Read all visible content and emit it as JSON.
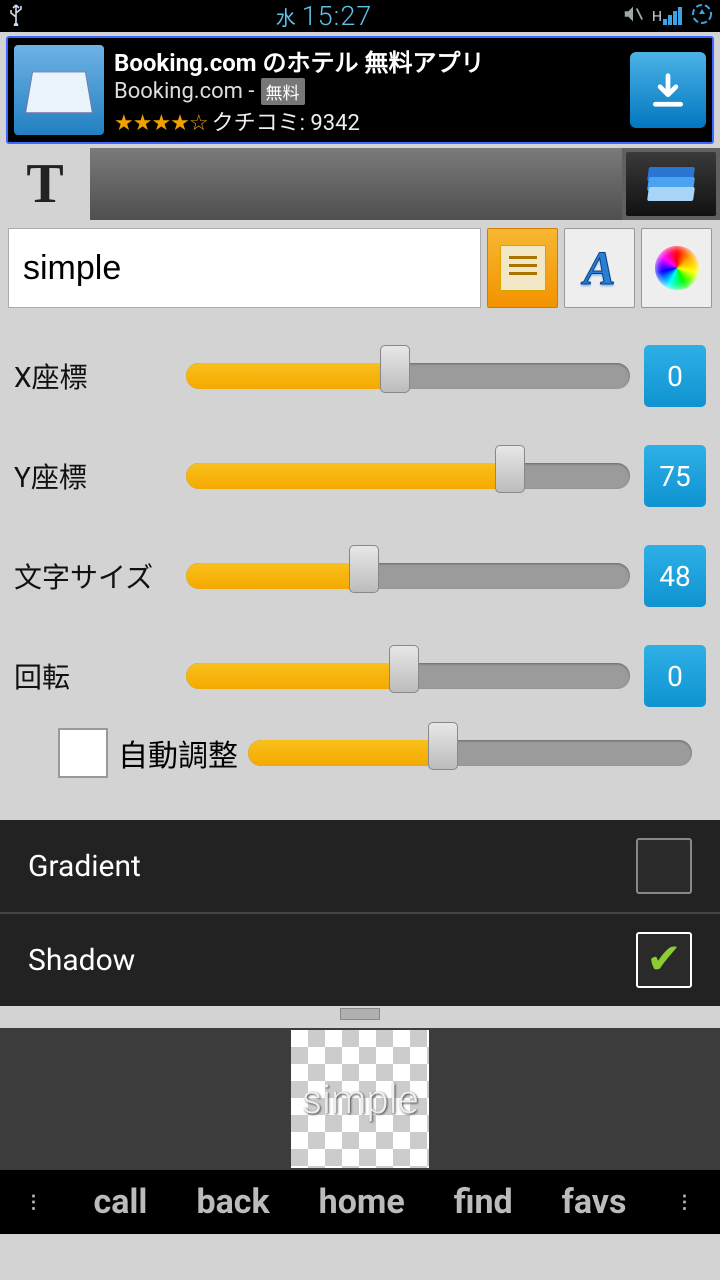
{
  "status": {
    "dow": "水",
    "clock": "15:27",
    "mobile": "H"
  },
  "ad": {
    "title": "Booking.com のホテル 無料アプリ",
    "publisher": "Booking.com - ",
    "free_badge": "無料",
    "stars": "★★★★☆",
    "reviews_label": "クチコミ: 9342"
  },
  "text_input": {
    "value": "simple"
  },
  "sliders": {
    "x": {
      "label": "X座標",
      "value": "0",
      "fill": 47
    },
    "y": {
      "label": "Y座標",
      "value": "75",
      "fill": 73
    },
    "size": {
      "label": "文字サイズ",
      "value": "48",
      "fill": 40
    },
    "rotate": {
      "label": "回転",
      "value": "0",
      "fill": 49
    },
    "auto": {
      "label": "自動調整",
      "fill": 44
    }
  },
  "options": {
    "gradient": {
      "label": "Gradient",
      "checked": false
    },
    "shadow": {
      "label": "Shadow",
      "checked": true
    }
  },
  "preview": {
    "sample_text": "simple"
  },
  "navbar": {
    "items": [
      "call",
      "back",
      "home",
      "find",
      "favs"
    ]
  }
}
